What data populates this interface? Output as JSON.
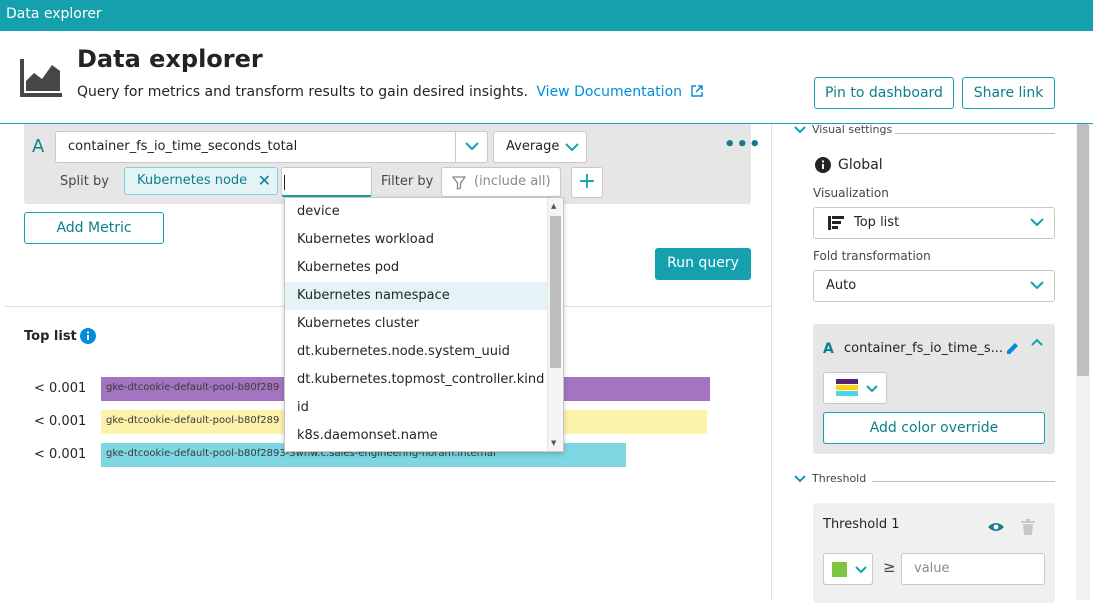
{
  "topbar": {
    "title": "Data explorer"
  },
  "header": {
    "title": "Data explorer",
    "subtitle": "Query for metrics and transform results to gain desired insights.",
    "doc_link": "View Documentation",
    "pin_label": "Pin to dashboard",
    "share_label": "Share link"
  },
  "query": {
    "letter": "A",
    "metric": "container_fs_io_time_seconds_total",
    "aggregation": "Average",
    "more": "•••",
    "split_label": "Split by",
    "split_chip": "Kubernetes node",
    "filter_label": "Filter by",
    "filter_placeholder": "(include all)",
    "add_label": "+",
    "add_metric_label": "Add Metric",
    "run_query_label": "Run query"
  },
  "dropdown": {
    "items": [
      "device",
      "Kubernetes workload",
      "Kubernetes pod",
      "Kubernetes namespace",
      "Kubernetes cluster",
      "dt.kubernetes.node.system_uuid",
      "dt.kubernetes.topmost_controller.kind",
      "id",
      "k8s.daemonset.name"
    ],
    "highlighted": "Kubernetes namespace"
  },
  "toplist": {
    "title": "Top list",
    "rows": [
      {
        "value": "< 0.001",
        "label": "gke-dtcookie-default-pool-b80f289",
        "fraction": 1.0,
        "color": "#a374bf"
      },
      {
        "value": "< 0.001",
        "label": "gke-dtcookie-default-pool-b80f289",
        "fraction": 0.995,
        "color": "#fdf2aa"
      },
      {
        "value": "< 0.001",
        "label": "gke-dtcookie-default-pool-b80f2893-3whw.c.sales-engineering-noram.internal",
        "fraction": 0.862,
        "color": "#7dd8e3"
      }
    ]
  },
  "settings": {
    "visual_header": "Visual settings",
    "global_label": "Global",
    "visualization_label": "Visualization",
    "visualization_value": "Top list",
    "fold_label": "Fold transformation",
    "fold_value": "Auto",
    "series_letter": "A",
    "series_name": "container_fs_io_time_s...",
    "add_color_label": "Add color override",
    "threshold_header": "Threshold",
    "threshold_title": "Threshold 1",
    "threshold_op": "≥",
    "threshold_placeholder": "value",
    "threshold_color": "#7dc540"
  },
  "colors": {
    "accent": "#14a0ad",
    "link": "#008cdb"
  }
}
